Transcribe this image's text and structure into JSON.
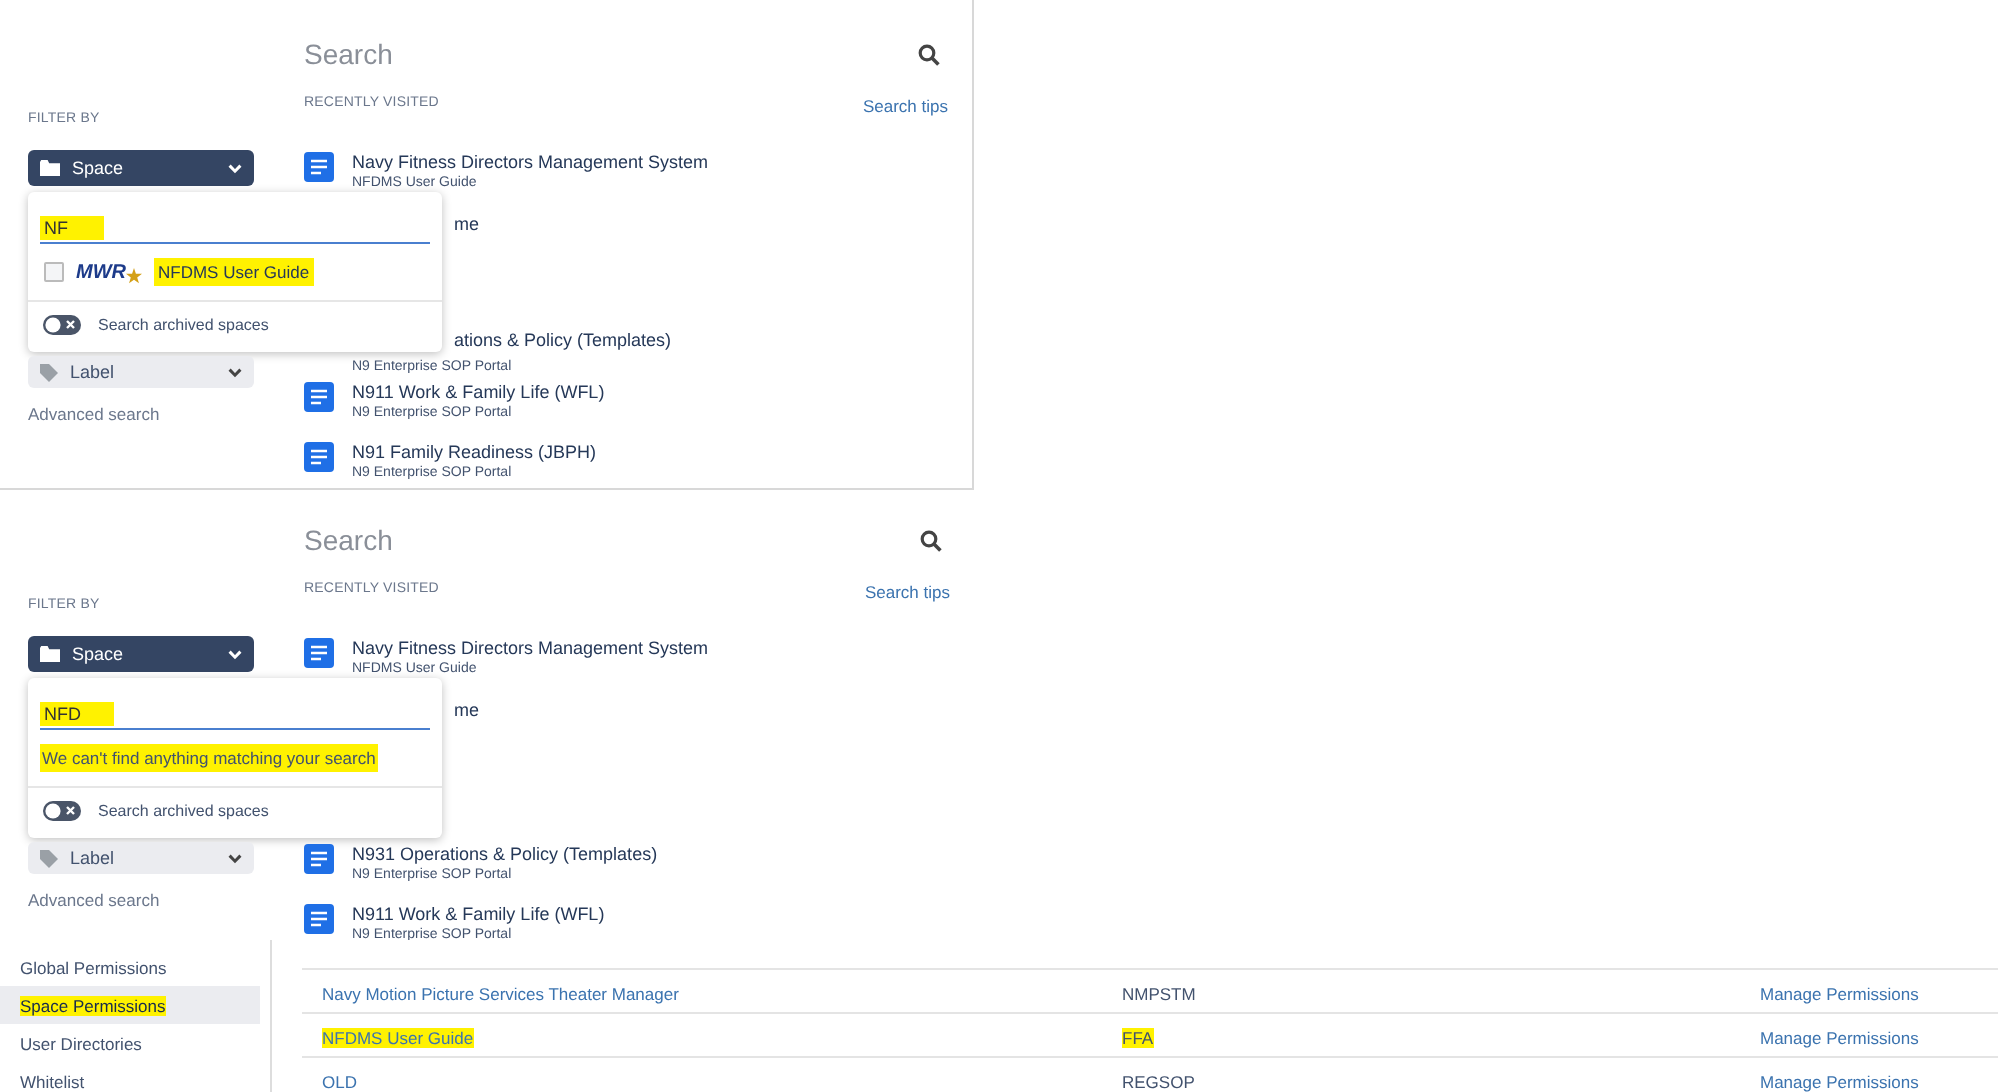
{
  "panels": [
    {
      "search": {
        "placeholder": "Search"
      },
      "filter_heading": "FILTER BY",
      "space_filter": "Space",
      "space_dropdown": {
        "query": "NF",
        "query_highlighted": true,
        "results": [
          {
            "logo": "MWR",
            "name": "NFDMS User Guide",
            "checked": false,
            "highlighted": true
          }
        ],
        "archived_toggle": {
          "label": "Search archived spaces",
          "on": false
        }
      },
      "label_filter": "Label",
      "advanced_search": "Advanced search",
      "recent_heading": "RECENTLY VISITED",
      "search_tips": "Search tips",
      "recent": [
        {
          "title": "Navy Fitness Directors Management System",
          "subtitle": "NFDMS User Guide",
          "covered": false
        },
        {
          "title": "me",
          "covered": true
        },
        {
          "title": "ations & Policy (Templates)",
          "subtitle": "N9 Enterprise SOP Portal",
          "covered": true
        },
        {
          "title": "N911 Work & Family Life (WFL)",
          "subtitle": "N9 Enterprise SOP Portal",
          "covered": false
        },
        {
          "title": "N91 Family Readiness (JBPH)",
          "subtitle": "N9 Enterprise SOP Portal",
          "covered": false
        }
      ]
    },
    {
      "search": {
        "placeholder": "Search"
      },
      "filter_heading": "FILTER BY",
      "space_filter": "Space",
      "space_dropdown": {
        "query": "NFD",
        "query_highlighted": true,
        "message": {
          "text": "We can't find anything matching your search",
          "highlighted": true
        },
        "archived_toggle": {
          "label": "Search archived spaces",
          "on": false
        }
      },
      "label_filter": "Label",
      "advanced_search": "Advanced search",
      "recent_heading": "RECENTLY VISITED",
      "search_tips": "Search tips",
      "recent": [
        {
          "title": "Navy Fitness Directors Management System",
          "subtitle": "NFDMS User Guide",
          "covered": false
        },
        {
          "title": "me",
          "covered": true
        },
        {
          "title": "N931 Operations & Policy (Templates)",
          "subtitle": "N9 Enterprise SOP Portal",
          "covered": false
        },
        {
          "title": "N911 Work & Family Life (WFL)",
          "subtitle": "N9 Enterprise SOP Portal",
          "covered": false
        }
      ]
    }
  ],
  "admin": {
    "sidebar": [
      {
        "label": "Global Permissions",
        "selected": false,
        "highlighted": false
      },
      {
        "label": "Space Permissions",
        "selected": true,
        "highlighted": true
      },
      {
        "label": "User Directories",
        "selected": false,
        "highlighted": false
      },
      {
        "label": "Whitelist",
        "selected": false,
        "highlighted": false
      }
    ],
    "spaces": [
      {
        "name": {
          "text": "Navy Motion Picture Services Theater Manager",
          "highlighted": false
        },
        "key": {
          "text": "NMPSTM",
          "highlighted": false
        },
        "action": "Manage Permissions"
      },
      {
        "name": {
          "text": "NFDMS User Guide",
          "highlighted": true
        },
        "key": {
          "text": "FFA",
          "highlighted": true
        },
        "action": "Manage Permissions"
      },
      {
        "name": {
          "text": "OLD",
          "highlighted": false
        },
        "key": {
          "text": "REGSOP",
          "highlighted": false
        },
        "action": "Manage Permissions"
      }
    ]
  }
}
